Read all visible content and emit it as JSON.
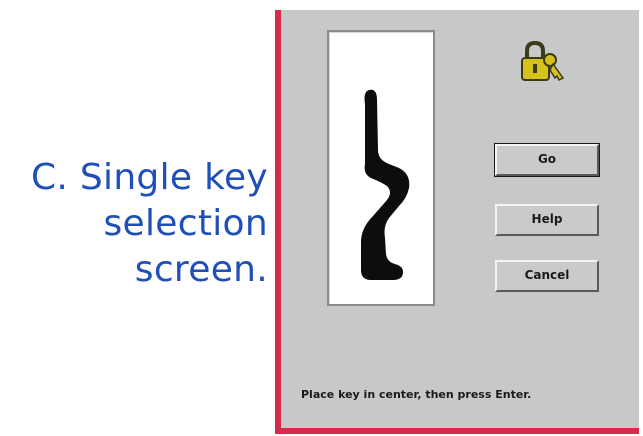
{
  "caption": {
    "line1": "C. Single key",
    "line2": "selection",
    "line3": "screen."
  },
  "dialog": {
    "buttons": {
      "go": "Go",
      "help": "Help",
      "cancel": "Cancel"
    },
    "status_text": "Place key in center, then press Enter.",
    "icons": {
      "lock": "padlock-with-key-icon",
      "key_preview": "key-silhouette"
    }
  },
  "colors": {
    "caption": "#1f4fb8",
    "frame_accent": "#d42a4c",
    "dialog_bg": "#c7c9c9",
    "lock_icon": "#d7c21a"
  }
}
